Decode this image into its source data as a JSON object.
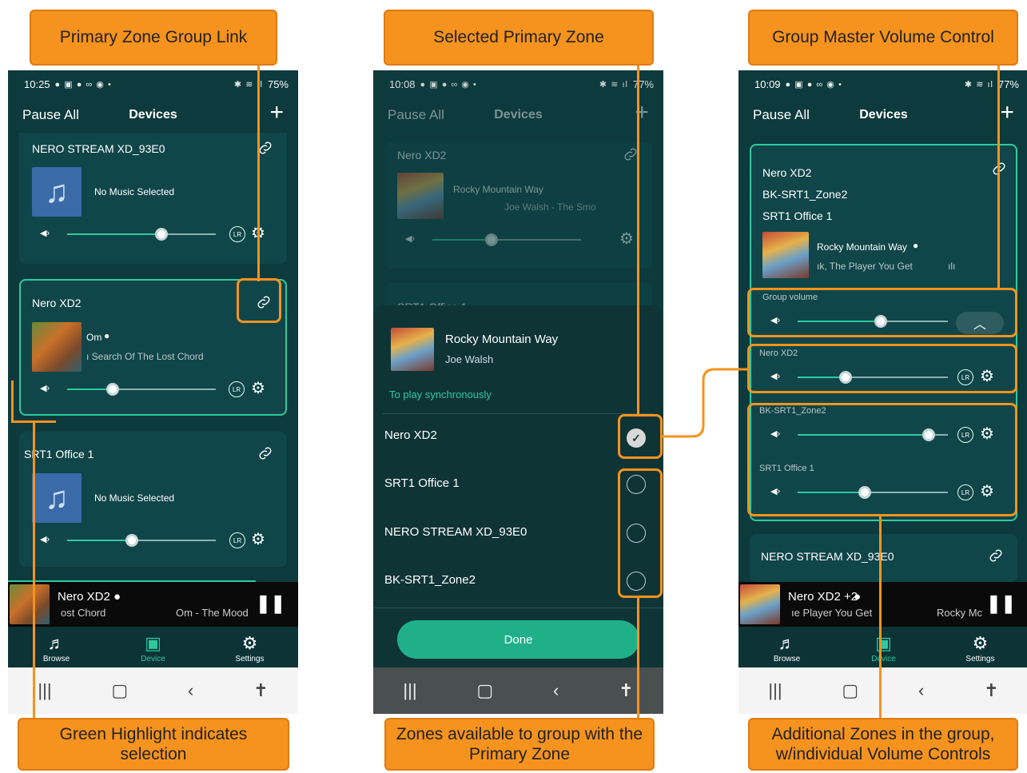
{
  "callouts": {
    "primary_link": "Primary Zone Group Link",
    "selected_primary": "Selected Primary Zone",
    "group_master": "Group Master Volume Control",
    "green_highlight": "Green Highlight indicates selection",
    "zones_available": "Zones available to group with the Primary Zone",
    "additional_zones": "Additional Zones in the group, w/individual Volume Controls"
  },
  "colors": {
    "accent": "#2fc9a0",
    "callout": "#f5931e",
    "app_bg": "#0d3a3c"
  },
  "phone1": {
    "status_time": "10:25",
    "status_right": "75%",
    "pause_all": "Pause All",
    "title": "Devices",
    "plus": "+",
    "zones": [
      {
        "name": "NERO STREAM XD_93E0",
        "track": "No Music Selected",
        "volume": 0.63
      },
      {
        "name": "Nero XD2",
        "track": "Om",
        "subtitle": "ı Search Of The Lost Chord",
        "volume": 0.3,
        "selected": true
      },
      {
        "name": "SRT1 Office 1",
        "track": "No Music Selected",
        "volume": 0.43
      }
    ],
    "lr": "LR",
    "now_playing": {
      "title": "Nero XD2",
      "sub": "ost Chord",
      "right": "Om - The Mood"
    },
    "tabs": [
      "Browse",
      "Device",
      "Settings"
    ]
  },
  "phone2": {
    "status_time": "10:08",
    "status_right": "77%",
    "pause_all": "Pause All",
    "title": "Devices",
    "plus": "+",
    "bg_zone": {
      "name": "Nero XD2",
      "track": "Rocky Mountain Way",
      "sub": "Joe Walsh - The Smo",
      "volume": 0.4
    },
    "bg_zone2": "SRT1 Office 1",
    "sheet": {
      "track": "Rocky Mountain Way",
      "artist": "Joe Walsh",
      "sync_label": "To play synchronously",
      "zones": [
        {
          "name": "Nero XD2",
          "checked": true
        },
        {
          "name": "SRT1 Office 1",
          "checked": false
        },
        {
          "name": "NERO STREAM XD_93E0",
          "checked": false
        },
        {
          "name": "BK-SRT1_Zone2",
          "checked": false
        }
      ],
      "done": "Done"
    }
  },
  "phone3": {
    "status_time": "10:09",
    "status_right": "77%",
    "pause_all": "Pause All",
    "title": "Devices",
    "plus": "+",
    "group_names": [
      "Nero XD2",
      "BK-SRT1_Zone2",
      "SRT1 Office 1"
    ],
    "track": "Rocky Mountain Way",
    "sub": "ık, The Player You Get",
    "group_volume_label": "Group volume",
    "group_volume": 0.56,
    "zone_volumes": [
      {
        "name": "Nero XD2",
        "volume": 0.3
      },
      {
        "name": "BK-SRT1_Zone2",
        "volume": 0.9
      },
      {
        "name": "SRT1 Office 1",
        "volume": 0.45
      }
    ],
    "lr": "LR",
    "next_zone": "NERO STREAM XD_93E0",
    "now_playing": {
      "title": "Nero XD2  +2",
      "sub": "ıe Player You Get",
      "right": "Rocky Mc"
    },
    "tabs": [
      "Browse",
      "Device",
      "Settings"
    ]
  }
}
